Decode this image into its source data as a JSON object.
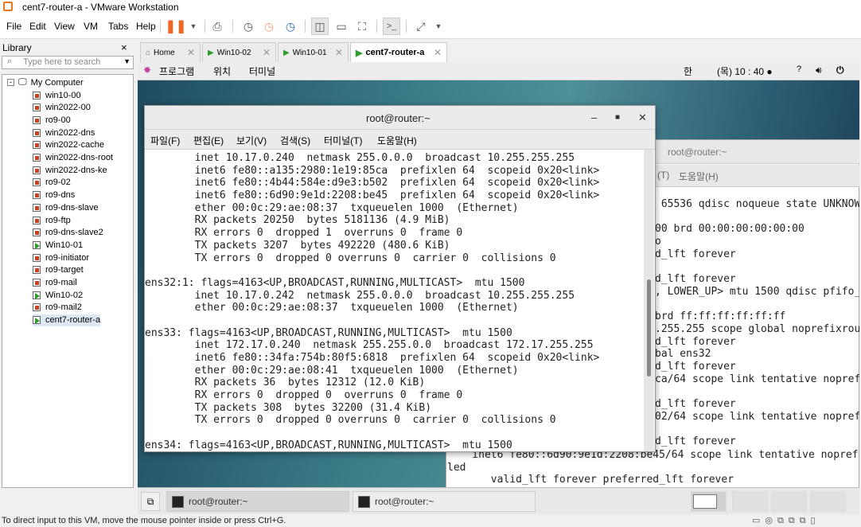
{
  "window": {
    "title": "cent7-router-a - VMware Workstation"
  },
  "menu": [
    "File",
    "Edit",
    "View",
    "VM",
    "Tabs",
    "Help"
  ],
  "toolbar": {
    "icons": [
      "pause-icon",
      "send-ctrl-alt-del-icon",
      "snapshot-take-icon",
      "snapshot-revert-icon",
      "snapshot-manager-icon",
      "library-view-icon",
      "thumbnail-view-icon",
      "fullscreen-icon",
      "console-view-icon",
      "stretch-icon"
    ],
    "accent": "#f26522"
  },
  "library": {
    "title": "Library",
    "close": "×",
    "search_placeholder": "Type here to search",
    "root": "My Computer",
    "items": [
      {
        "label": "win10-00",
        "state": "off"
      },
      {
        "label": "win2022-00",
        "state": "off"
      },
      {
        "label": "ro9-00",
        "state": "off"
      },
      {
        "label": "win2022-dns",
        "state": "off"
      },
      {
        "label": "win2022-cache",
        "state": "off"
      },
      {
        "label": "win2022-dns-root",
        "state": "off"
      },
      {
        "label": "win2022-dns-ke",
        "state": "off"
      },
      {
        "label": "ro9-02",
        "state": "off"
      },
      {
        "label": "ro9-dns",
        "state": "off"
      },
      {
        "label": "ro9-dns-slave",
        "state": "off"
      },
      {
        "label": "ro9-ftp",
        "state": "off"
      },
      {
        "label": "ro9-dns-slave2",
        "state": "off"
      },
      {
        "label": "Win10-01",
        "state": "run"
      },
      {
        "label": "ro9-initiator",
        "state": "off"
      },
      {
        "label": "ro9-target",
        "state": "off"
      },
      {
        "label": "ro9-mail",
        "state": "off"
      },
      {
        "label": "Win10-02",
        "state": "run"
      },
      {
        "label": "ro9-mail2",
        "state": "off"
      },
      {
        "label": "cent7-router-a",
        "state": "run",
        "selected": true
      }
    ]
  },
  "tabs": [
    {
      "label": "Home"
    },
    {
      "label": "Win10-02"
    },
    {
      "label": "Win10-01"
    },
    {
      "label": "cent7-router-a",
      "active": true
    }
  ],
  "gnome": {
    "apps": "프로그램",
    "places": "위치",
    "terminal": "터미널",
    "ime": "한",
    "clock": "(목) 10 : 40 ●"
  },
  "front_terminal": {
    "title": "root@router:~",
    "menu": [
      "파일(F)",
      "편집(E)",
      "보기(V)",
      "검색(S)",
      "터미널(T)",
      "도움말(H)"
    ],
    "lines": [
      "        inet 10.17.0.240  netmask 255.0.0.0  broadcast 10.255.255.255",
      "        inet6 fe80::a135:2980:1e19:85ca  prefixlen 64  scopeid 0x20<link>",
      "        inet6 fe80::4b44:584e:d9e3:b502  prefixlen 64  scopeid 0x20<link>",
      "        inet6 fe80::6d90:9e1d:2208:be45  prefixlen 64  scopeid 0x20<link>",
      "        ether 00:0c:29:ae:08:37  txqueuelen 1000  (Ethernet)",
      "        RX packets 20250  bytes 5181136 (4.9 MiB)",
      "        RX errors 0  dropped 1  overruns 0  frame 0",
      "        TX packets 3207  bytes 492220 (480.6 KiB)",
      "        TX errors 0  dropped 0 overruns 0  carrier 0  collisions 0",
      "",
      "ens32:1: flags=4163<UP,BROADCAST,RUNNING,MULTICAST>  mtu 1500",
      "        inet 10.17.0.242  netmask 255.0.0.0  broadcast 10.255.255.255",
      "        ether 00:0c:29:ae:08:37  txqueuelen 1000  (Ethernet)",
      "",
      "ens33: flags=4163<UP,BROADCAST,RUNNING,MULTICAST>  mtu 1500",
      "        inet 172.17.0.240  netmask 255.255.0.0  broadcast 172.17.255.255",
      "        inet6 fe80::34fa:754b:80f5:6818  prefixlen 64  scopeid 0x20<link>",
      "        ether 00:0c:29:ae:08:41  txqueuelen 1000  (Ethernet)",
      "        RX packets 36  bytes 12312 (12.0 KiB)",
      "        RX errors 0  dropped 0  overruns 0  frame 0",
      "        TX packets 308  bytes 32200 (31.4 KiB)",
      "        TX errors 0  dropped 0 overruns 0  carrier 0  collisions 0",
      "",
      "ens34: flags=4163<UP,BROADCAST,RUNNING,MULTICAST>  mtu 1500"
    ]
  },
  "back_terminal": {
    "title": "root@router:~",
    "menu_visible": [
      "(T)",
      "도움말(H)"
    ],
    "right_lines": [
      " 65536 qdisc noqueue state UNKNOWN",
      "",
      "00 brd 00:00:00:00:00:00",
      "o",
      "d_lft forever",
      "",
      "d_lft forever",
      ", LOWER_UP> mtu 1500 qdisc pfifo_f",
      "",
      "brd ff:ff:ff:ff:ff:ff",
      ".255.255 scope global noprefixrou",
      "d_lft forever",
      "bal ens32",
      "d_lft forever",
      "ca/64 scope link tentative nopref",
      "",
      "d_lft forever",
      "02/64 scope link tentative nopref",
      "",
      "d_lft forever"
    ],
    "bottom_lines": [
      "    inet6 fe80::6d90:9e1d:2208:be45/64 scope link tentative nopref",
      "led",
      "       valid_lft forever preferred_lft forever"
    ]
  },
  "taskbar": {
    "tasks": [
      "root@router:~",
      "root@router:~"
    ]
  },
  "status": {
    "text": "To direct input to this VM, move the mouse pointer inside or press Ctrl+G."
  }
}
